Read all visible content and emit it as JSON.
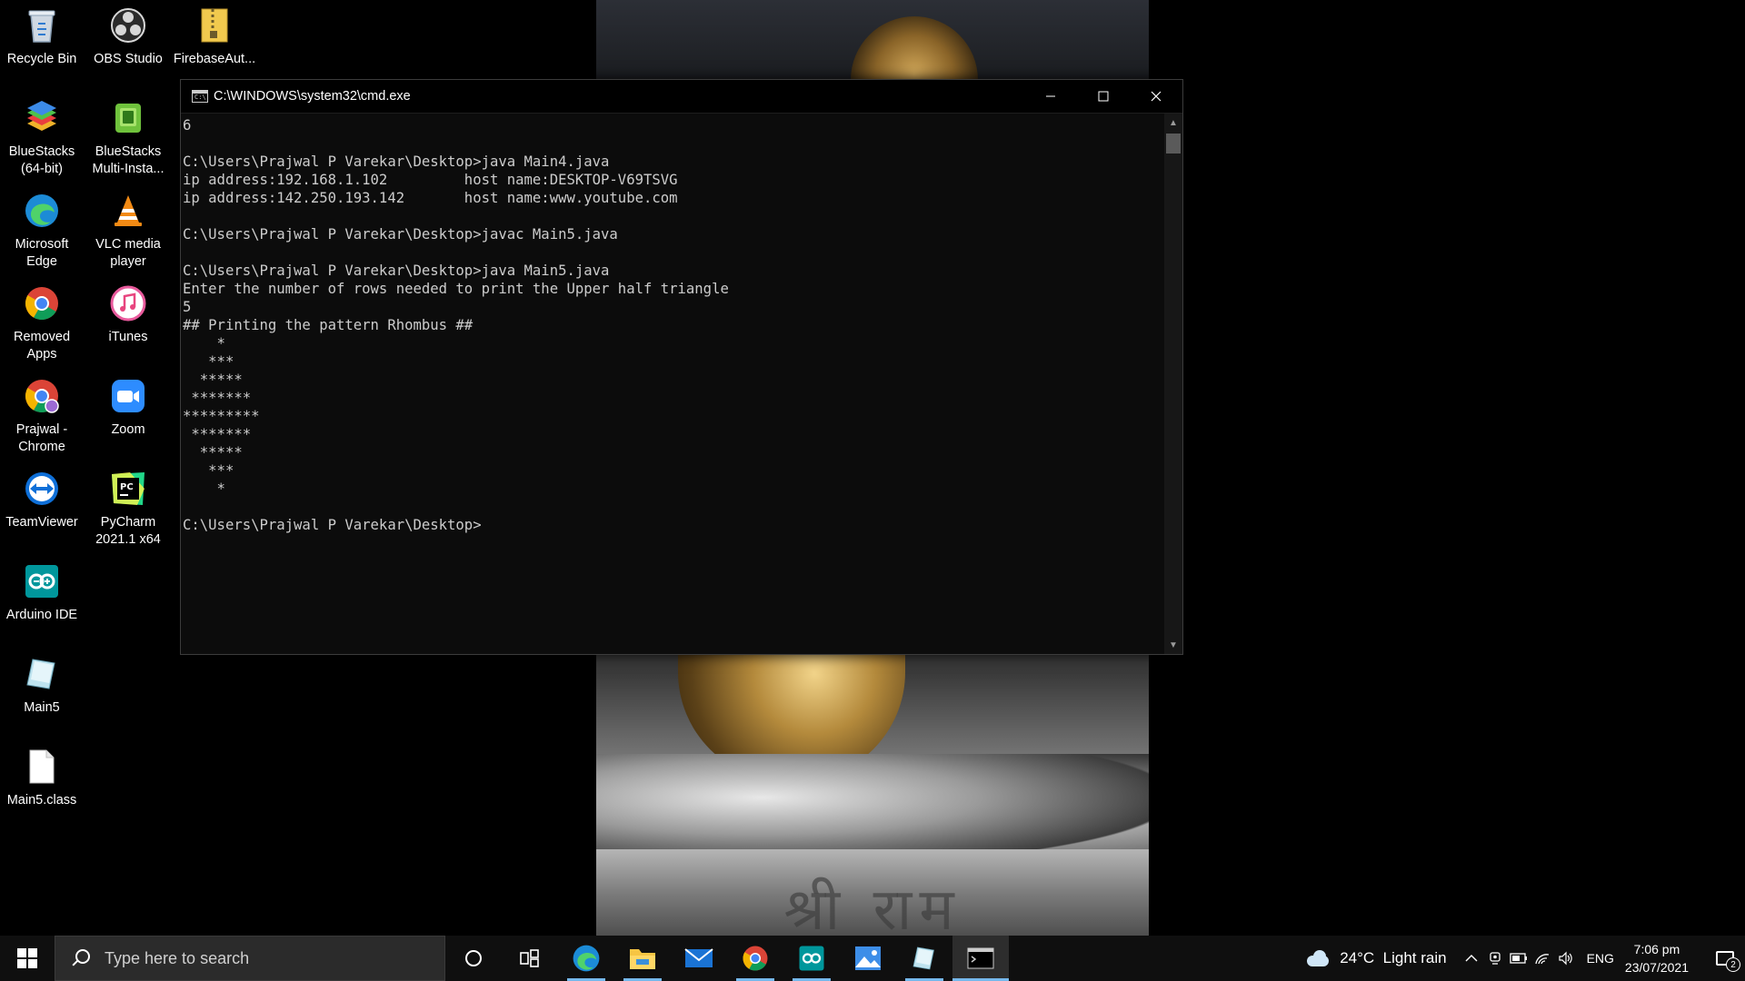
{
  "desktop": {
    "icons": [
      {
        "label": "Recycle Bin"
      },
      {
        "label": "OBS Studio"
      },
      {
        "label": "FirebaseAut..."
      },
      {
        "label": "BlueStacks (64-bit)"
      },
      {
        "label": "BlueStacks Multi-Insta..."
      },
      {
        "label": "Microsoft Edge"
      },
      {
        "label": "VLC media player"
      },
      {
        "label": "Removed Apps"
      },
      {
        "label": "iTunes"
      },
      {
        "label": "Prajwal - Chrome"
      },
      {
        "label": "Zoom"
      },
      {
        "label": "TeamViewer"
      },
      {
        "label": "PyCharm 2021.1 x64"
      },
      {
        "label": "Arduino IDE"
      },
      {
        "label": "Main5"
      },
      {
        "label": "Main5.class"
      }
    ],
    "wallpaper_text": "श्री राम"
  },
  "console": {
    "title": "C:\\WINDOWS\\system32\\cmd.exe",
    "lines": [
      "6",
      "",
      "C:\\Users\\Prajwal P Varekar\\Desktop>java Main4.java",
      "ip address:192.168.1.102         host name:DESKTOP-V69TSVG",
      "ip address:142.250.193.142       host name:www.youtube.com",
      "",
      "C:\\Users\\Prajwal P Varekar\\Desktop>javac Main5.java",
      "",
      "C:\\Users\\Prajwal P Varekar\\Desktop>java Main5.java",
      "Enter the number of rows needed to print the Upper half triangle",
      "5",
      "## Printing the pattern Rhombus ##",
      "    *",
      "   ***",
      "  *****",
      " *******",
      "*********",
      " *******",
      "  *****",
      "   ***",
      "    *",
      "",
      "C:\\Users\\Prajwal P Varekar\\Desktop>"
    ]
  },
  "taskbar": {
    "search_placeholder": "Type here to search",
    "pinned": [
      {
        "icon": "cortana-icon"
      },
      {
        "icon": "task-view-icon"
      },
      {
        "icon": "edge-icon"
      },
      {
        "icon": "file-explorer-icon"
      },
      {
        "icon": "mail-icon"
      },
      {
        "icon": "chrome-icon"
      },
      {
        "icon": "arduino-icon"
      },
      {
        "icon": "photos-icon"
      },
      {
        "icon": "java-file-icon"
      },
      {
        "icon": "cmd-icon"
      }
    ],
    "weather": {
      "temp": "24°C",
      "condition": "Light rain"
    },
    "language": "ENG",
    "time": "7:06 pm",
    "date": "23/07/2021",
    "notification_count": "2"
  },
  "colors": {
    "console_bg": "#0c0c0c",
    "console_text": "#cccccc",
    "taskbar_bg": "#0f0f0f",
    "accent": "#76b9ed"
  }
}
